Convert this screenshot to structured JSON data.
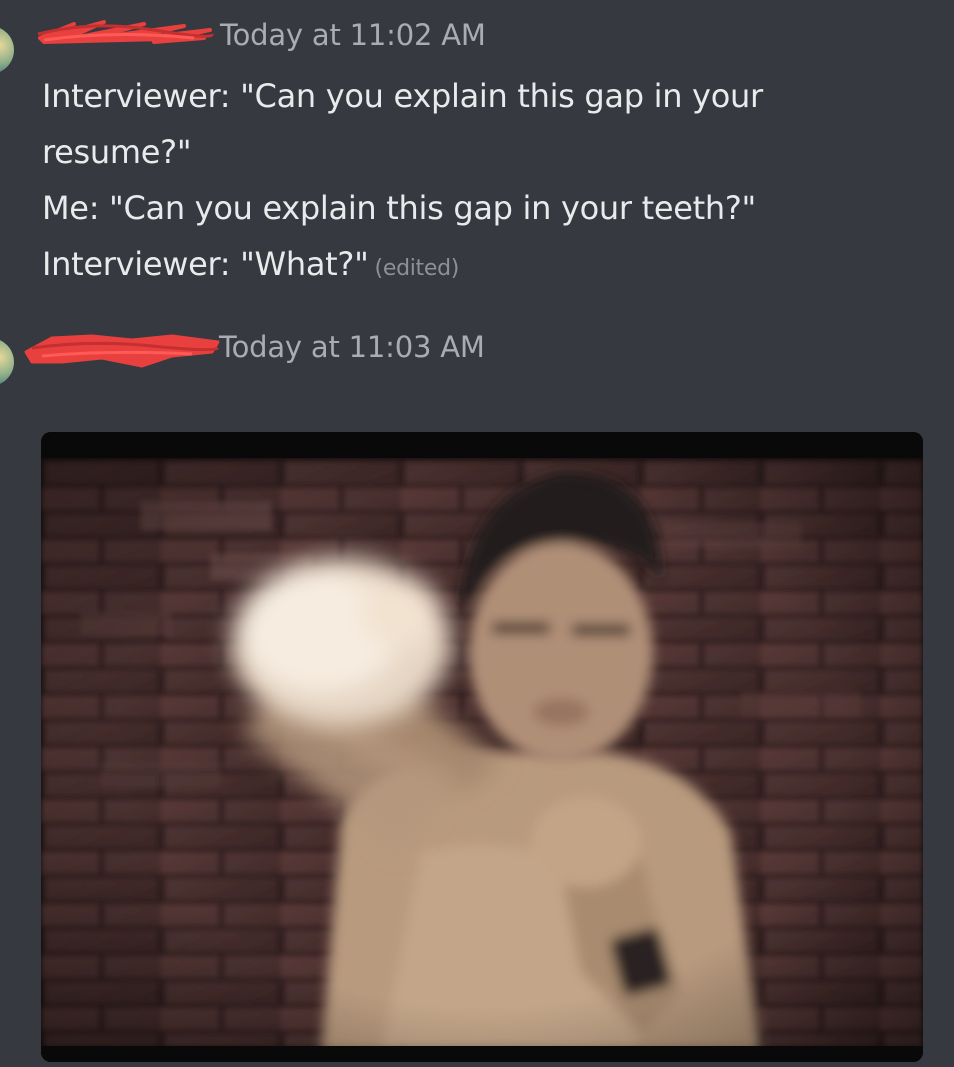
{
  "messages": [
    {
      "timestamp": "Today at 11:02 AM",
      "lines": [
        "Interviewer: \"Can you explain this gap in your",
        "resume?\"",
        "Me: \"Can you explain this gap in your teeth?\"",
        "Interviewer: \"What?\""
      ],
      "edited_label": "(edited)"
    },
    {
      "timestamp": "Today at 11:03 AM",
      "attachment": {
        "kind": "image",
        "subject": "shirtless man punching toward camera in front of brick wall"
      }
    }
  ],
  "colors": {
    "background": "#36393f",
    "text": "#e9eaec",
    "timestamp": "#a9acb1",
    "redaction": "#e8403f"
  }
}
